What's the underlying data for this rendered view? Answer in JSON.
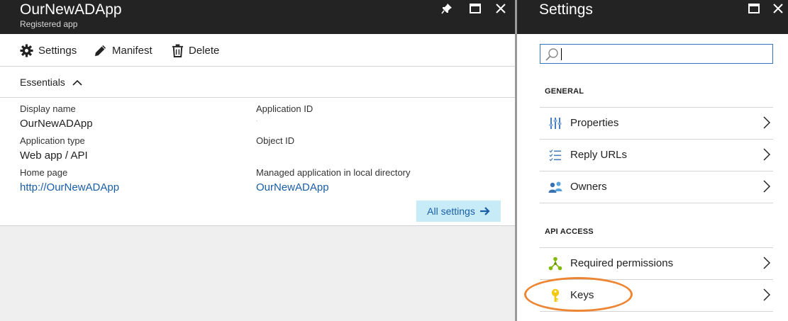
{
  "app_blade": {
    "title": "OurNewADApp",
    "subtitle": "Registered app",
    "toolbar": {
      "settings_label": "Settings",
      "manifest_label": "Manifest",
      "delete_label": "Delete"
    },
    "essentials_label": "Essentials",
    "properties": {
      "display_name_label": "Display name",
      "display_name_value": "OurNewADApp",
      "application_type_label": "Application type",
      "application_type_value": "Web app / API",
      "home_page_label": "Home page",
      "home_page_value": "http://OurNewADApp",
      "application_id_label": "Application ID",
      "application_id_value": ".",
      "object_id_label": "Object ID",
      "managed_app_label": "Managed application in local directory",
      "managed_app_value": "OurNewADApp"
    },
    "all_settings_label": "All settings"
  },
  "settings_blade": {
    "title": "Settings",
    "search": {
      "value": "",
      "placeholder": ""
    },
    "general_header": "GENERAL",
    "general_items": [
      {
        "label": "Properties",
        "icon": "properties-icon"
      },
      {
        "label": "Reply URLs",
        "icon": "reply-urls-icon"
      },
      {
        "label": "Owners",
        "icon": "owners-icon"
      }
    ],
    "api_access_header": "API ACCESS",
    "api_items": [
      {
        "label": "Required permissions",
        "icon": "required-permissions-icon"
      },
      {
        "label": "Keys",
        "icon": "key-icon"
      }
    ]
  },
  "colors": {
    "header_bg": "#232323",
    "link": "#1a5ea8",
    "all_settings_bg": "#c7ecf7",
    "search_border": "#2a74c3",
    "highlight": "#ee8533",
    "key_icon": "#f2c811",
    "permissions_icon": "#7fba00"
  }
}
